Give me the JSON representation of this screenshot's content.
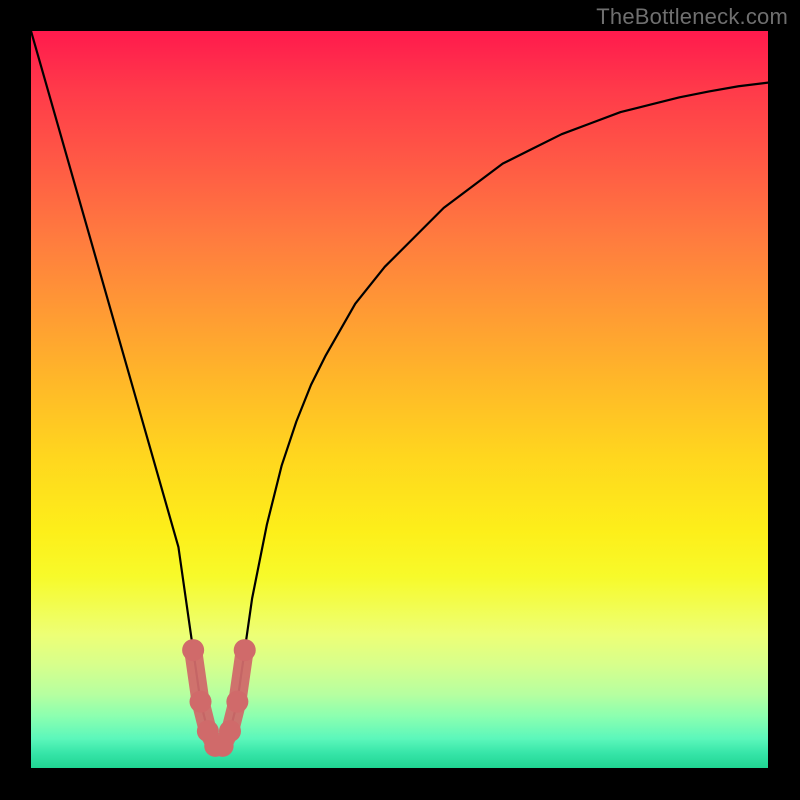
{
  "watermark": "TheBottleneck.com",
  "chart_data": {
    "type": "line",
    "title": "",
    "xlabel": "",
    "ylabel": "",
    "xlim": [
      0,
      100
    ],
    "ylim": [
      0,
      100
    ],
    "x": [
      0,
      2,
      4,
      6,
      8,
      10,
      12,
      14,
      16,
      18,
      20,
      22,
      23,
      24,
      25,
      26,
      27,
      28,
      29,
      30,
      32,
      34,
      36,
      38,
      40,
      44,
      48,
      52,
      56,
      60,
      64,
      68,
      72,
      76,
      80,
      84,
      88,
      92,
      96,
      100
    ],
    "series": [
      {
        "name": "bottleneck-curve",
        "values": [
          100,
          93,
          86,
          79,
          72,
          65,
          58,
          51,
          44,
          37,
          30,
          16,
          9,
          5,
          3,
          3,
          5,
          9,
          16,
          23,
          33,
          41,
          47,
          52,
          56,
          63,
          68,
          72,
          76,
          79,
          82,
          84,
          86,
          87.5,
          89,
          90,
          91,
          91.8,
          92.5,
          93
        ]
      }
    ],
    "highlight": {
      "color": "#d06a6a",
      "x_range": [
        22,
        29
      ],
      "points": [
        {
          "x": 22,
          "y": 16
        },
        {
          "x": 23,
          "y": 9
        },
        {
          "x": 24,
          "y": 5
        },
        {
          "x": 25,
          "y": 3
        },
        {
          "x": 26,
          "y": 3
        },
        {
          "x": 27,
          "y": 5
        },
        {
          "x": 28,
          "y": 9
        },
        {
          "x": 29,
          "y": 16
        }
      ]
    },
    "background_gradient": {
      "top": "#ff1a4d",
      "middle": "#ffd71e",
      "bottom": "#20d492"
    }
  }
}
